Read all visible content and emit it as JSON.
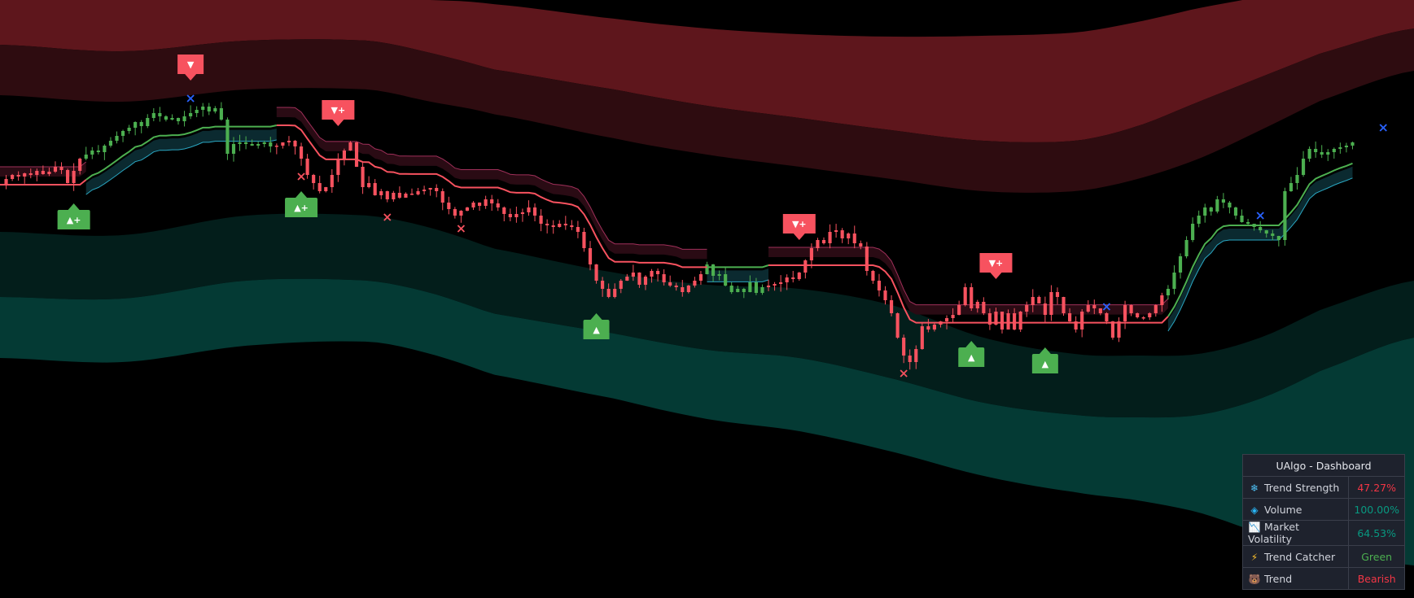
{
  "chart_data": {
    "type": "candlestick",
    "title": "",
    "xlabel": "",
    "ylabel": "",
    "grid": false,
    "x_range": [
      0,
      230
    ],
    "y_range": [
      0,
      735
    ],
    "colors": {
      "background": "#000000",
      "bull": "#4caf50",
      "bear": "#f7525f",
      "trend_line_bear": "#f7525f",
      "trend_line_bull": "#4caf50",
      "upper_cloud": "#2a0b14",
      "upper_cloud_edge": "#a0305a",
      "lower_cloud": "#0b2a30",
      "lower_cloud_edge": "#2aa7c2",
      "upper_band_outer": "#5e161c",
      "upper_band_inner": "#2e0c10",
      "lower_band_inner": "#031e1b",
      "lower_band_outer": "#043a34",
      "x_mark_blue": "#2962ff",
      "x_mark_red": "#f7525f"
    },
    "note_units": "y values are price units on an inverted-free scale where higher number = higher price (0..735)",
    "bands": {
      "x": [
        0,
        20,
        40,
        60,
        70,
        80,
        100,
        115,
        130,
        145,
        160,
        175,
        185,
        195,
        205,
        215,
        230
      ],
      "upper_outer_top": [
        735,
        735,
        735,
        735,
        735,
        730,
        712,
        700,
        693,
        690,
        691,
        695,
        708,
        725,
        740,
        765,
        790
      ],
      "upper_outer_bottom": [
        680,
        672,
        685,
        685,
        670,
        650,
        625,
        605,
        590,
        575,
        562,
        562,
        580,
        610,
        640,
        670,
        700
      ],
      "upper_inner_bottom": [
        618,
        610,
        625,
        625,
        610,
        595,
        565,
        545,
        530,
        515,
        500,
        500,
        515,
        540,
        575,
        612,
        648
      ],
      "lower_inner_top": [
        450,
        446,
        470,
        470,
        455,
        430,
        400,
        385,
        380,
        360,
        320,
        300,
        298,
        300,
        320,
        355,
        390
      ],
      "lower_inner_bottom": [
        370,
        368,
        390,
        390,
        375,
        350,
        325,
        305,
        295,
        270,
        240,
        225,
        222,
        225,
        245,
        280,
        320
      ],
      "lower_outer_bottom": [
        295,
        290,
        310,
        315,
        300,
        275,
        245,
        220,
        205,
        180,
        150,
        130,
        120,
        105,
        80,
        60,
        40
      ]
    },
    "price": [
      508,
      515,
      520,
      518,
      522,
      520,
      525,
      521,
      524,
      530,
      526,
      510,
      525,
      540,
      545,
      550,
      548,
      556,
      562,
      568,
      574,
      578,
      585,
      580,
      590,
      596,
      592,
      588,
      590,
      586,
      592,
      596,
      600,
      604,
      598,
      602,
      588,
      546,
      558,
      560,
      558,
      556,
      558,
      560,
      555,
      556,
      560,
      562,
      555,
      540,
      520,
      510,
      500,
      505,
      520,
      540,
      550,
      560,
      530,
      505,
      510,
      495,
      500,
      490,
      498,
      492,
      497,
      496,
      500,
      502,
      504,
      500,
      486,
      478,
      470,
      476,
      480,
      486,
      482,
      490,
      485,
      480,
      472,
      468,
      472,
      474,
      480,
      470,
      460,
      458,
      456,
      460,
      458,
      456,
      450,
      430,
      410,
      390,
      380,
      370,
      380,
      390,
      395,
      400,
      385,
      395,
      402,
      398,
      388,
      384,
      382,
      376,
      384,
      390,
      398,
      410,
      396,
      398,
      384,
      376,
      380,
      376,
      388,
      375,
      382,
      384,
      386,
      388,
      394,
      392,
      400,
      415,
      430,
      440,
      436,
      450,
      452,
      442,
      448,
      436,
      432,
      402,
      390,
      378,
      366,
      350,
      320,
      298,
      290,
      306,
      334,
      330,
      336,
      340,
      344,
      348,
      360,
      382,
      356,
      364,
      350,
      336,
      352,
      330,
      350,
      330,
      352,
      360,
      370,
      362,
      348,
      376,
      370,
      350,
      340,
      330,
      352,
      360,
      356,
      350,
      340,
      320,
      340,
      360,
      350,
      345,
      345,
      350,
      360,
      372,
      380,
      400,
      420,
      440,
      460,
      470,
      480,
      475,
      490,
      486,
      480,
      470,
      462,
      460,
      456,
      452,
      448,
      445,
      440,
      500,
      510,
      520,
      540,
      552,
      548,
      545,
      548,
      552,
      554,
      556,
      560
    ],
    "trend_line": {
      "description": "step trend follow line; colors switch bull/bear",
      "segments": [
        {
          "x0": 0,
          "x1": 14,
          "color": "bear"
        },
        {
          "x0": 14,
          "x1": 45,
          "color": "bull"
        },
        {
          "x0": 45,
          "x1": 115,
          "color": "bear"
        },
        {
          "x0": 115,
          "x1": 125,
          "color": "bull"
        },
        {
          "x0": 125,
          "x1": 190,
          "color": "bear"
        },
        {
          "x0": 190,
          "x1": 230,
          "color": "bull"
        }
      ]
    },
    "signals": [
      {
        "x": 12,
        "dir": "up",
        "label": "▲+"
      },
      {
        "x": 31,
        "dir": "down",
        "label": "▼"
      },
      {
        "x": 49,
        "dir": "up",
        "label": "▲+"
      },
      {
        "x": 55,
        "dir": "down",
        "label": "▼+"
      },
      {
        "x": 97,
        "dir": "up",
        "label": "▲"
      },
      {
        "x": 130,
        "dir": "down",
        "label": "▼+"
      },
      {
        "x": 158,
        "dir": "up",
        "label": "▲"
      },
      {
        "x": 162,
        "dir": "down",
        "label": "▼+"
      },
      {
        "x": 170,
        "dir": "up",
        "label": "▲"
      }
    ],
    "x_marks": [
      {
        "x": 31,
        "color": "blue",
        "pos": "above"
      },
      {
        "x": 49,
        "color": "red",
        "pos": "below"
      },
      {
        "x": 63,
        "color": "red",
        "pos": "below"
      },
      {
        "x": 75,
        "color": "red",
        "pos": "below"
      },
      {
        "x": 147,
        "color": "red",
        "pos": "below"
      },
      {
        "x": 180,
        "color": "blue",
        "pos": "above"
      },
      {
        "x": 205,
        "color": "blue",
        "pos": "above"
      },
      {
        "x": 225,
        "color": "blue",
        "pos": "above"
      }
    ]
  },
  "dashboard": {
    "title": "UAlgo - Dashboard",
    "rows": [
      {
        "icon": "snowflake-icon",
        "glyph": "❄",
        "icon_color": "#4fc3f7",
        "label": "Trend Strength",
        "value": "47.27%",
        "value_color": "#f23645"
      },
      {
        "icon": "diamond-icon",
        "glyph": "◈",
        "icon_color": "#29b6f6",
        "label": "Volume",
        "value": "100.00%",
        "value_color": "#089981"
      },
      {
        "icon": "chart-down-icon",
        "glyph": "📉",
        "icon_color": "#90caf9",
        "label": "Market Volatility",
        "value": "64.53%",
        "value_color": "#089981"
      },
      {
        "icon": "lightning-icon",
        "glyph": "⚡",
        "icon_color": "#fbc02d",
        "label": "Trend Catcher",
        "value": "Green",
        "value_color": "#4caf50"
      },
      {
        "icon": "bear-icon",
        "glyph": "🐻",
        "icon_color": "#c07a4a",
        "label": "Trend",
        "value": "Bearish",
        "value_color": "#f23645"
      }
    ]
  }
}
